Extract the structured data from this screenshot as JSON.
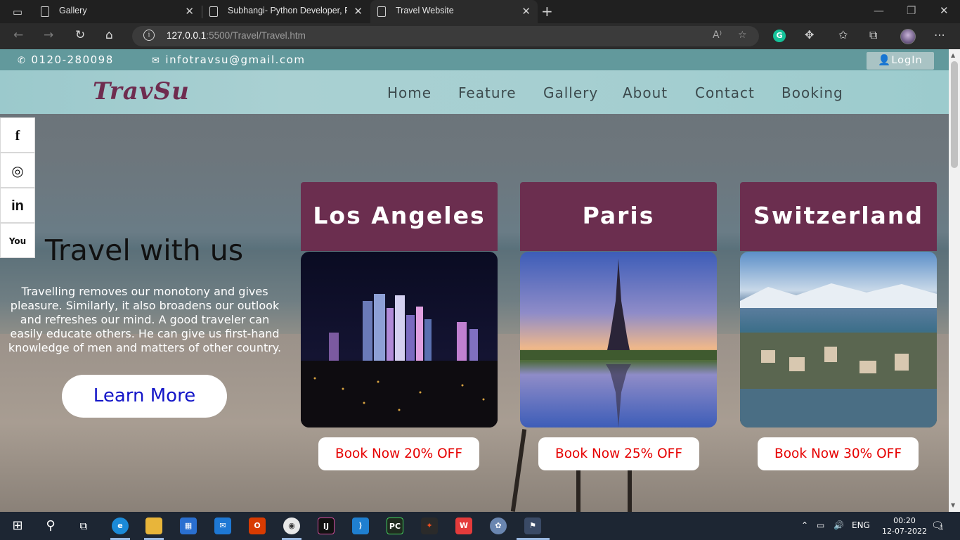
{
  "browser": {
    "tabs": [
      {
        "title": "Gallery"
      },
      {
        "title": "Subhangi- Python Developer, Fro"
      },
      {
        "title": "Travel Website"
      }
    ],
    "url_host": "127.0.0.1",
    "url_rest": ":5500/Travel/Travel.htm"
  },
  "topbar": {
    "phone": "0120-280098",
    "email": "infotravsu@gmail.com",
    "login_label": "LogIn"
  },
  "header": {
    "logo": "TravSu",
    "nav": [
      "Home",
      "Feature",
      "Gallery",
      "About",
      "Contact",
      "Booking"
    ]
  },
  "social": [
    {
      "name": "facebook-icon",
      "glyph": "f"
    },
    {
      "name": "instagram-icon",
      "glyph": "◎"
    },
    {
      "name": "linkedin-icon",
      "glyph": "in"
    },
    {
      "name": "youtube-icon",
      "glyph": "▶"
    }
  ],
  "hero": {
    "title": "Travel with us",
    "text": "Travelling removes our monotony and gives pleasure. Similarly, it also broadens our outlook and refreshes our mind. A good traveler can easily educate others. He can give us first-hand knowledge of men and matters of other country.",
    "button": "Learn More"
  },
  "cards": [
    {
      "title": "Los Angeles",
      "button": "Book Now 20% OFF"
    },
    {
      "title": "Paris",
      "button": "Book Now 25% OFF"
    },
    {
      "title": "Switzerland",
      "button": "Book Now 30% OFF"
    }
  ],
  "taskbar": {
    "language": "ENG",
    "time": "00:20",
    "date": "12-07-2022",
    "notification_count": "1"
  },
  "colors": {
    "brand": "#6b2e4f",
    "topbar": "#62999c",
    "book_text": "#e60000",
    "learn_text": "#1416c8"
  }
}
